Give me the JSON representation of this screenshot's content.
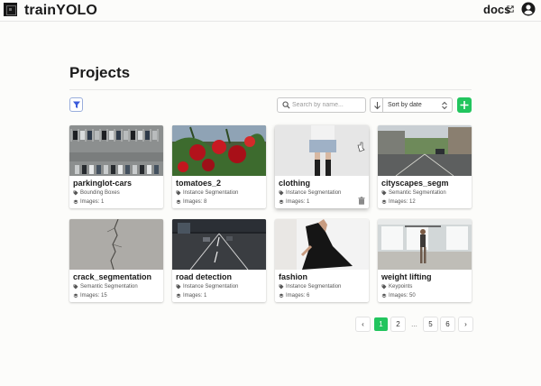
{
  "app": {
    "brand": "trainYOLO",
    "docs_label": "docs"
  },
  "page": {
    "title": "Projects"
  },
  "toolbar": {
    "search_placeholder": "Search by name...",
    "sort_label": "Sort by date"
  },
  "projects": [
    {
      "name": "parkinglot-cars",
      "type": "Bounding Boxes",
      "images": "Images: 1"
    },
    {
      "name": "tomatoes_2",
      "type": "Instance Segmentation",
      "images": "Images: 8"
    },
    {
      "name": "clothing",
      "type": "Instance Segmentation",
      "images": "Images: 1"
    },
    {
      "name": "cityscapes_segm",
      "type": "Semantic Segmentation",
      "images": "Images: 12"
    },
    {
      "name": "crack_segmentation",
      "type": "Semantic Segmentation",
      "images": "Images: 15"
    },
    {
      "name": "road detection",
      "type": "Instance Segmentation",
      "images": "Images: 1"
    },
    {
      "name": "fashion",
      "type": "Instance Segmentation",
      "images": "Images: 6"
    },
    {
      "name": "weight lifting",
      "type": "Keypoints",
      "images": "Images: 50"
    }
  ],
  "pagination": {
    "prev": "‹",
    "next": "›",
    "pages": [
      "1",
      "2",
      "5",
      "6"
    ],
    "ellipsis": "...",
    "current": "1"
  },
  "colors": {
    "accent_green": "#22c55e",
    "filter_blue": "#3b5bdb"
  },
  "icons": [
    "external-link-icon",
    "account-icon",
    "filter-icon",
    "search-icon",
    "arrow-down-icon",
    "sort-chevron-icon",
    "plus-icon",
    "tag-icon",
    "layers-icon",
    "trash-icon"
  ]
}
